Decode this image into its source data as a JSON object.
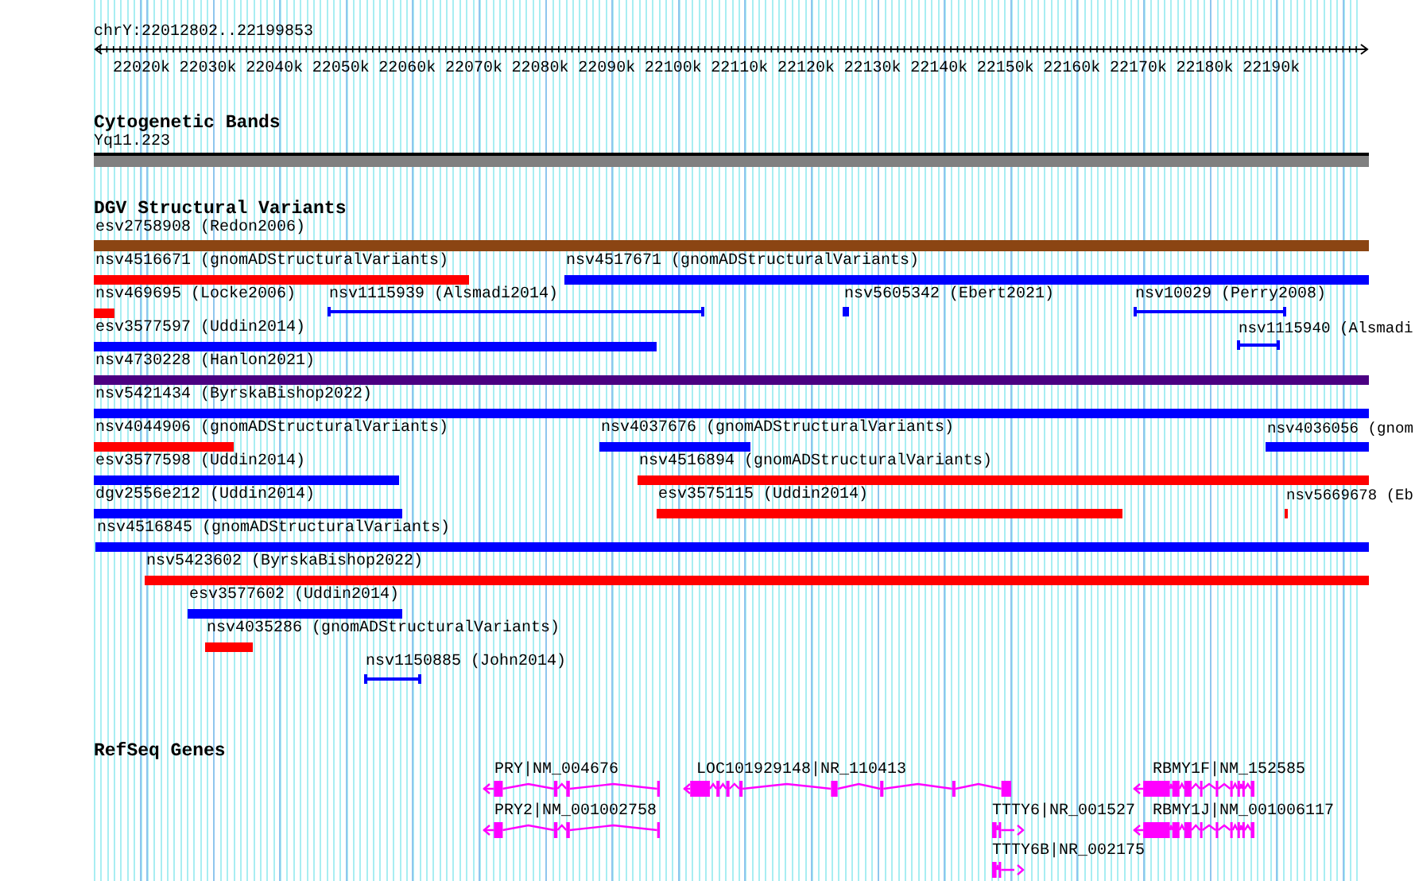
{
  "ruler": {
    "location": "chrY:22012802..22199853",
    "tick_labels": [
      "22020k",
      "22030k",
      "22040k",
      "22050k",
      "22060k",
      "22070k",
      "22080k",
      "22090k",
      "22100k",
      "22110k",
      "22120k",
      "22130k",
      "22140k",
      "22150k",
      "22160k",
      "22170k",
      "22180k",
      "22190k"
    ]
  },
  "cytogenetic_bands": {
    "title": "Cytogenetic Bands",
    "bands": [
      {
        "label": "Yq11.223",
        "color": "#808080"
      }
    ]
  },
  "dgv_structural_variants": {
    "title": "DGV Structural Variants",
    "rows": [
      {
        "features": [
          {
            "label": "esv2758908 (Redon2006)",
            "kind": "bar",
            "color": "#8b4513"
          }
        ]
      },
      {
        "features": [
          {
            "label": "nsv4516671 (gnomADStructuralVariants)",
            "kind": "bar",
            "color": "#ff0000"
          },
          {
            "label": "nsv4517671 (gnomADStructuralVariants)",
            "kind": "bar",
            "color": "#0000ff"
          }
        ]
      },
      {
        "features": [
          {
            "label": "nsv469695 (Locke2006)",
            "kind": "bar",
            "color": "#ff0000"
          },
          {
            "label": "nsv1115939 (Alsmadi2014)",
            "kind": "span",
            "color": "#0000ff"
          },
          {
            "label": "nsv5605342 (Ebert2021)",
            "kind": "span",
            "color": "#0000ff"
          },
          {
            "label": "nsv10029 (Perry2008)",
            "kind": "span",
            "color": "#0000ff"
          }
        ]
      },
      {
        "features": [
          {
            "label": "esv3577597 (Uddin2014)",
            "kind": "bar",
            "color": "#0000ff"
          },
          {
            "label": "nsv1115940 (Alsmadi",
            "kind": "span",
            "color": "#0000ff"
          }
        ]
      },
      {
        "features": [
          {
            "label": "nsv4730228 (Hanlon2021)",
            "kind": "bar",
            "color": "#4b0082"
          }
        ]
      },
      {
        "features": [
          {
            "label": "nsv5421434 (ByrskaBishop2022)",
            "kind": "bar",
            "color": "#0000ff"
          }
        ]
      },
      {
        "features": [
          {
            "label": "nsv4044906 (gnomADStructuralVariants)",
            "kind": "bar",
            "color": "#ff0000"
          },
          {
            "label": "nsv4037676 (gnomADStructuralVariants)",
            "kind": "bar",
            "color": "#0000ff"
          },
          {
            "label": "nsv4036056 (gnom",
            "kind": "bar",
            "color": "#0000ff"
          }
        ]
      },
      {
        "features": [
          {
            "label": "esv3577598 (Uddin2014)",
            "kind": "bar",
            "color": "#0000ff"
          },
          {
            "label": "nsv4516894 (gnomADStructuralVariants)",
            "kind": "bar",
            "color": "#ff0000"
          }
        ]
      },
      {
        "features": [
          {
            "label": "dgv2556e212 (Uddin2014)",
            "kind": "bar",
            "color": "#0000ff"
          },
          {
            "label": "esv3575115 (Uddin2014)",
            "kind": "bar",
            "color": "#ff0000"
          },
          {
            "label": "nsv5669678 (Eb",
            "kind": "bar",
            "color": "#ff0000"
          }
        ]
      },
      {
        "features": [
          {
            "label": "nsv4516845 (gnomADStructuralVariants)",
            "kind": "bar",
            "color": "#0000ff"
          }
        ]
      },
      {
        "features": [
          {
            "label": "nsv5423602 (ByrskaBishop2022)",
            "kind": "bar",
            "color": "#ff0000"
          }
        ]
      },
      {
        "features": [
          {
            "label": "esv3577602 (Uddin2014)",
            "kind": "bar",
            "color": "#0000ff"
          }
        ]
      },
      {
        "features": [
          {
            "label": "nsv4035286 (gnomADStructuralVariants)",
            "kind": "bar",
            "color": "#ff0000"
          }
        ]
      },
      {
        "features": [
          {
            "label": "nsv1150885 (John2014)",
            "kind": "span",
            "color": "#0000ff"
          }
        ]
      }
    ]
  },
  "refseq_genes": {
    "title": "RefSeq Genes",
    "genes": [
      {
        "label": "PRY|NM_004676",
        "reverse_strand": true
      },
      {
        "label": "PRY2|NM_001002758",
        "reverse_strand": true
      },
      {
        "label": "LOC101929148|NR_110413",
        "reverse_strand": true
      },
      {
        "label": "TTTY6|NR_001527",
        "reverse_strand": false
      },
      {
        "label": "TTTY6B|NR_002175",
        "reverse_strand": false
      },
      {
        "label": "RBMY1F|NM_152585",
        "reverse_strand": true
      },
      {
        "label": "RBMY1J|NM_001006117",
        "reverse_strand": true
      }
    ]
  }
}
